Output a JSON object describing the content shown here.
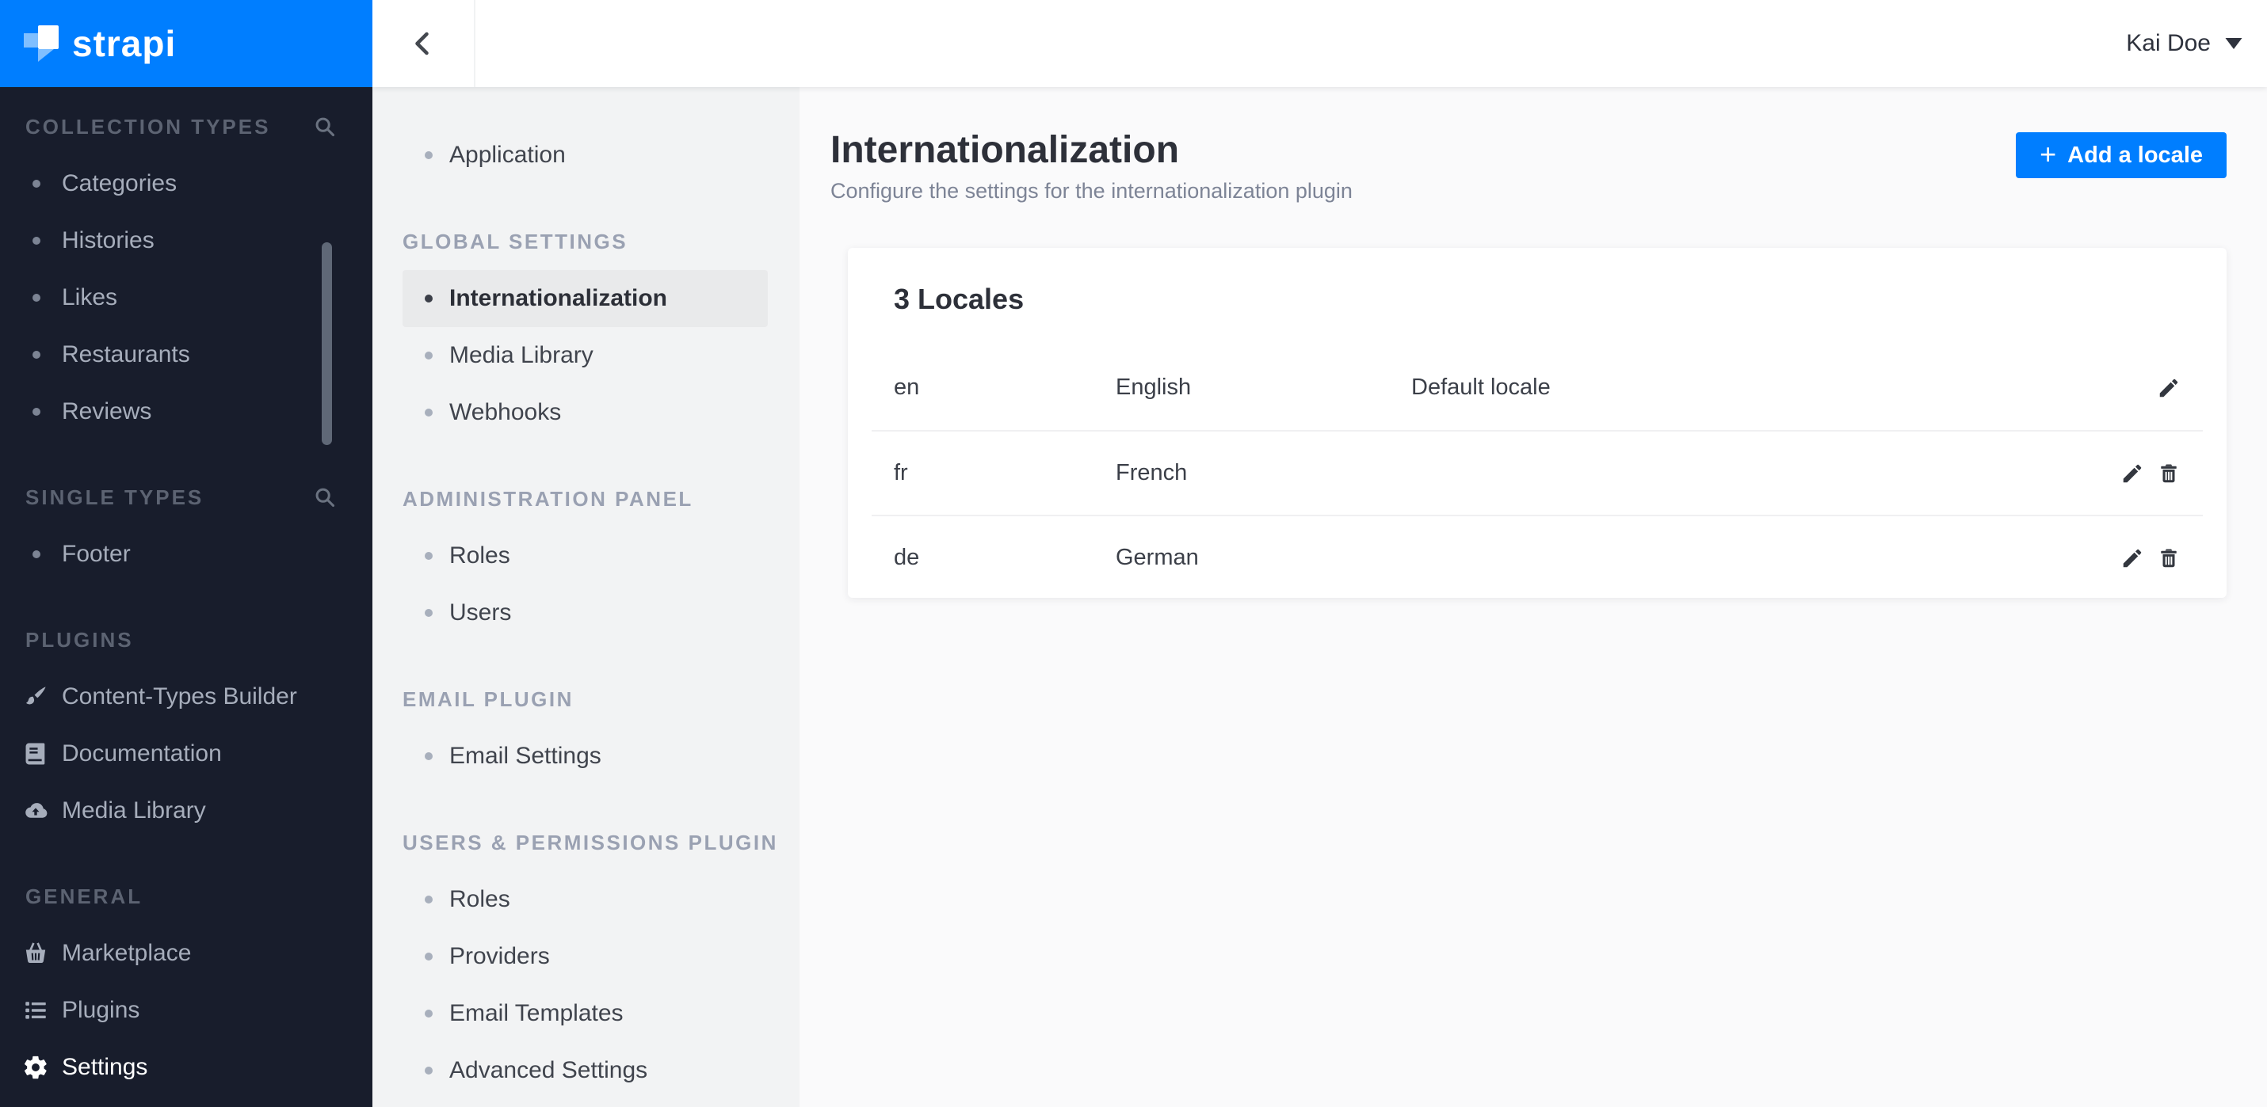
{
  "brand": {
    "name": "strapi"
  },
  "topbar": {
    "user_name": "Kai Doe"
  },
  "nav": {
    "sections": [
      {
        "label": "COLLECTION TYPES",
        "has_search": true,
        "items": [
          {
            "label": "Categories"
          },
          {
            "label": "Histories"
          },
          {
            "label": "Likes"
          },
          {
            "label": "Restaurants"
          },
          {
            "label": "Reviews"
          }
        ]
      },
      {
        "label": "SINGLE TYPES",
        "has_search": true,
        "items": [
          {
            "label": "Footer"
          }
        ]
      },
      {
        "label": "PLUGINS",
        "has_search": false,
        "items": [
          {
            "label": "Content-Types Builder",
            "icon": "brush-icon"
          },
          {
            "label": "Documentation",
            "icon": "book-icon"
          },
          {
            "label": "Media Library",
            "icon": "cloud-upload-icon"
          }
        ]
      },
      {
        "label": "GENERAL",
        "has_search": false,
        "items": [
          {
            "label": "Marketplace",
            "icon": "basket-icon"
          },
          {
            "label": "Plugins",
            "icon": "list-icon"
          },
          {
            "label": "Settings",
            "icon": "gear-icon",
            "active": true
          }
        ]
      }
    ]
  },
  "settings_nav": {
    "top_items": [
      {
        "label": "Application"
      }
    ],
    "sections": [
      {
        "label": "GLOBAL SETTINGS",
        "items": [
          {
            "label": "Internationalization",
            "active": true
          },
          {
            "label": "Media Library"
          },
          {
            "label": "Webhooks"
          }
        ]
      },
      {
        "label": "ADMINISTRATION PANEL",
        "items": [
          {
            "label": "Roles"
          },
          {
            "label": "Users"
          }
        ]
      },
      {
        "label": "EMAIL PLUGIN",
        "items": [
          {
            "label": "Email Settings"
          }
        ]
      },
      {
        "label": "USERS & PERMISSIONS PLUGIN",
        "items": [
          {
            "label": "Roles"
          },
          {
            "label": "Providers"
          },
          {
            "label": "Email Templates"
          },
          {
            "label": "Advanced Settings"
          }
        ]
      }
    ]
  },
  "page": {
    "title": "Internationalization",
    "subtitle": "Configure the settings for the internationalization plugin",
    "add_locale_button": "Add a locale",
    "plus_sign": "+"
  },
  "locales_card": {
    "title": "3 Locales",
    "rows": [
      {
        "code": "en",
        "name": "English",
        "status": "Default locale",
        "can_delete": false
      },
      {
        "code": "fr",
        "name": "French",
        "status": "",
        "can_delete": true
      },
      {
        "code": "de",
        "name": "German",
        "status": "",
        "can_delete": true
      }
    ]
  },
  "colors": {
    "accent": "#007eff",
    "dark_sidebar_bg": "#181d2c",
    "light_sidebar_bg": "#f2f3f4",
    "main_bg": "#fafafb",
    "active_item_bg": "#e9eaeb"
  }
}
